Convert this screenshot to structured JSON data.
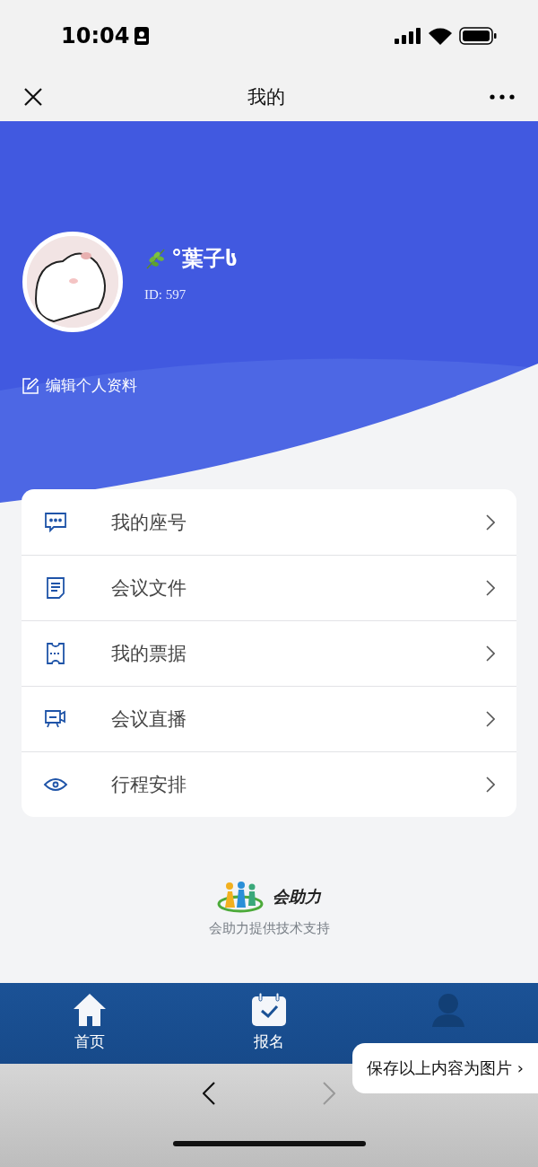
{
  "status_bar": {
    "time": "10:04"
  },
  "nav_bar": {
    "title": "我的"
  },
  "profile": {
    "name": "°葉子ს",
    "id": "ID: 597",
    "edit_label": "编辑个人资料"
  },
  "menu": [
    {
      "label": "我的座号"
    },
    {
      "label": "会议文件"
    },
    {
      "label": "我的票据"
    },
    {
      "label": "会议直播"
    },
    {
      "label": "行程安排"
    }
  ],
  "footer": {
    "logo_text": "会助力",
    "credit": "会助力提供技术支持"
  },
  "tabs": [
    {
      "label": "首页",
      "selected": false
    },
    {
      "label": "报名",
      "selected": false
    },
    {
      "selected": true
    }
  ],
  "save_popup": {
    "label": "保存以上内容为图片 ›"
  }
}
